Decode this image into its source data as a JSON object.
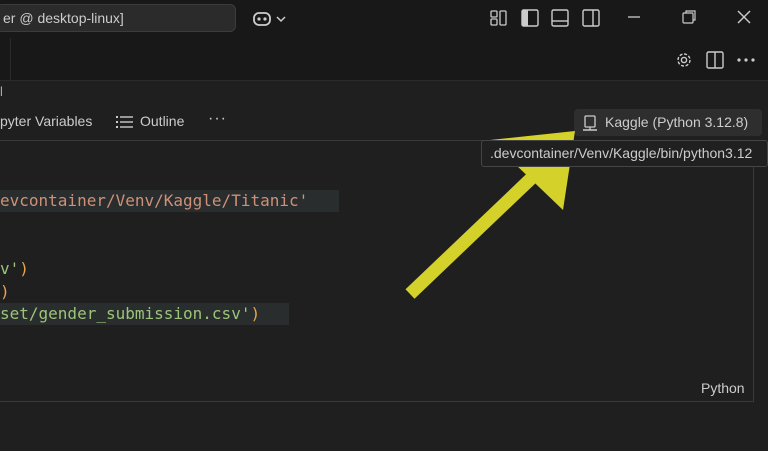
{
  "titlebar": {
    "search_text": "er @ desktop-linux]",
    "copilot_icon": "copilot-icon",
    "layout_icons": [
      "customize-layout-icon",
      "toggle-primary-sidebar-icon",
      "toggle-panel-icon",
      "toggle-secondary-sidebar-icon"
    ],
    "window_controls": [
      "minimize-icon",
      "restore-icon",
      "close-icon"
    ]
  },
  "editor_actions": [
    "gear-icon",
    "split-editor-icon",
    "more-actions-icon"
  ],
  "breadcrumb": {
    "text": "l"
  },
  "notebook_toolbar": {
    "variables_label": "pyter Variables",
    "outline_label": "Outline",
    "more_label": "···"
  },
  "kernel": {
    "label": "Kaggle (Python 3.12.8)",
    "tooltip": ".devcontainer/Venv/Kaggle/bin/python3.12"
  },
  "code": {
    "line1": "evcontainer/Venv/Kaggle/Titanic'",
    "line2": "v'",
    "line2_paren": ")",
    "line3_paren": ")",
    "line4": "set/gender_submission.csv'",
    "line4_paren": ")"
  },
  "cell": {
    "language": "Python"
  },
  "annotation": {
    "arrow_color": "#d4d22a"
  },
  "colors": {
    "background": "#1f1f1f",
    "titlebar": "#181818",
    "accent": "#d4d22a"
  }
}
